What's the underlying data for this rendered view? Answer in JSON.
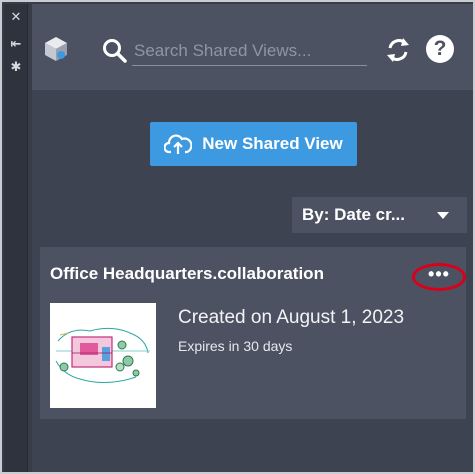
{
  "side_strip": {
    "close_glyph": "✕",
    "pin_glyph": "⇤",
    "settings_glyph": "✱"
  },
  "header": {
    "search_placeholder": "Search Shared Views...",
    "help_glyph": "?"
  },
  "actions": {
    "new_shared_view_label": "New Shared View"
  },
  "sort": {
    "label": "By: Date cr..."
  },
  "shared_views": [
    {
      "title": "Office Headquarters.collaboration",
      "created": "Created on August 1, 2023",
      "expires": "Expires in 30 days",
      "more_glyph": "•••"
    }
  ],
  "colors": {
    "accent": "#3d9ae0",
    "highlight_ring": "#d9001b",
    "panel": "#3e4351",
    "toolbar": "#4d5262"
  },
  "icons": [
    "close-icon",
    "pin-icon",
    "settings-icon",
    "cube-icon",
    "search-icon",
    "sync-icon",
    "help-icon",
    "cloud-upload-icon",
    "chevron-down-icon",
    "more-icon"
  ]
}
